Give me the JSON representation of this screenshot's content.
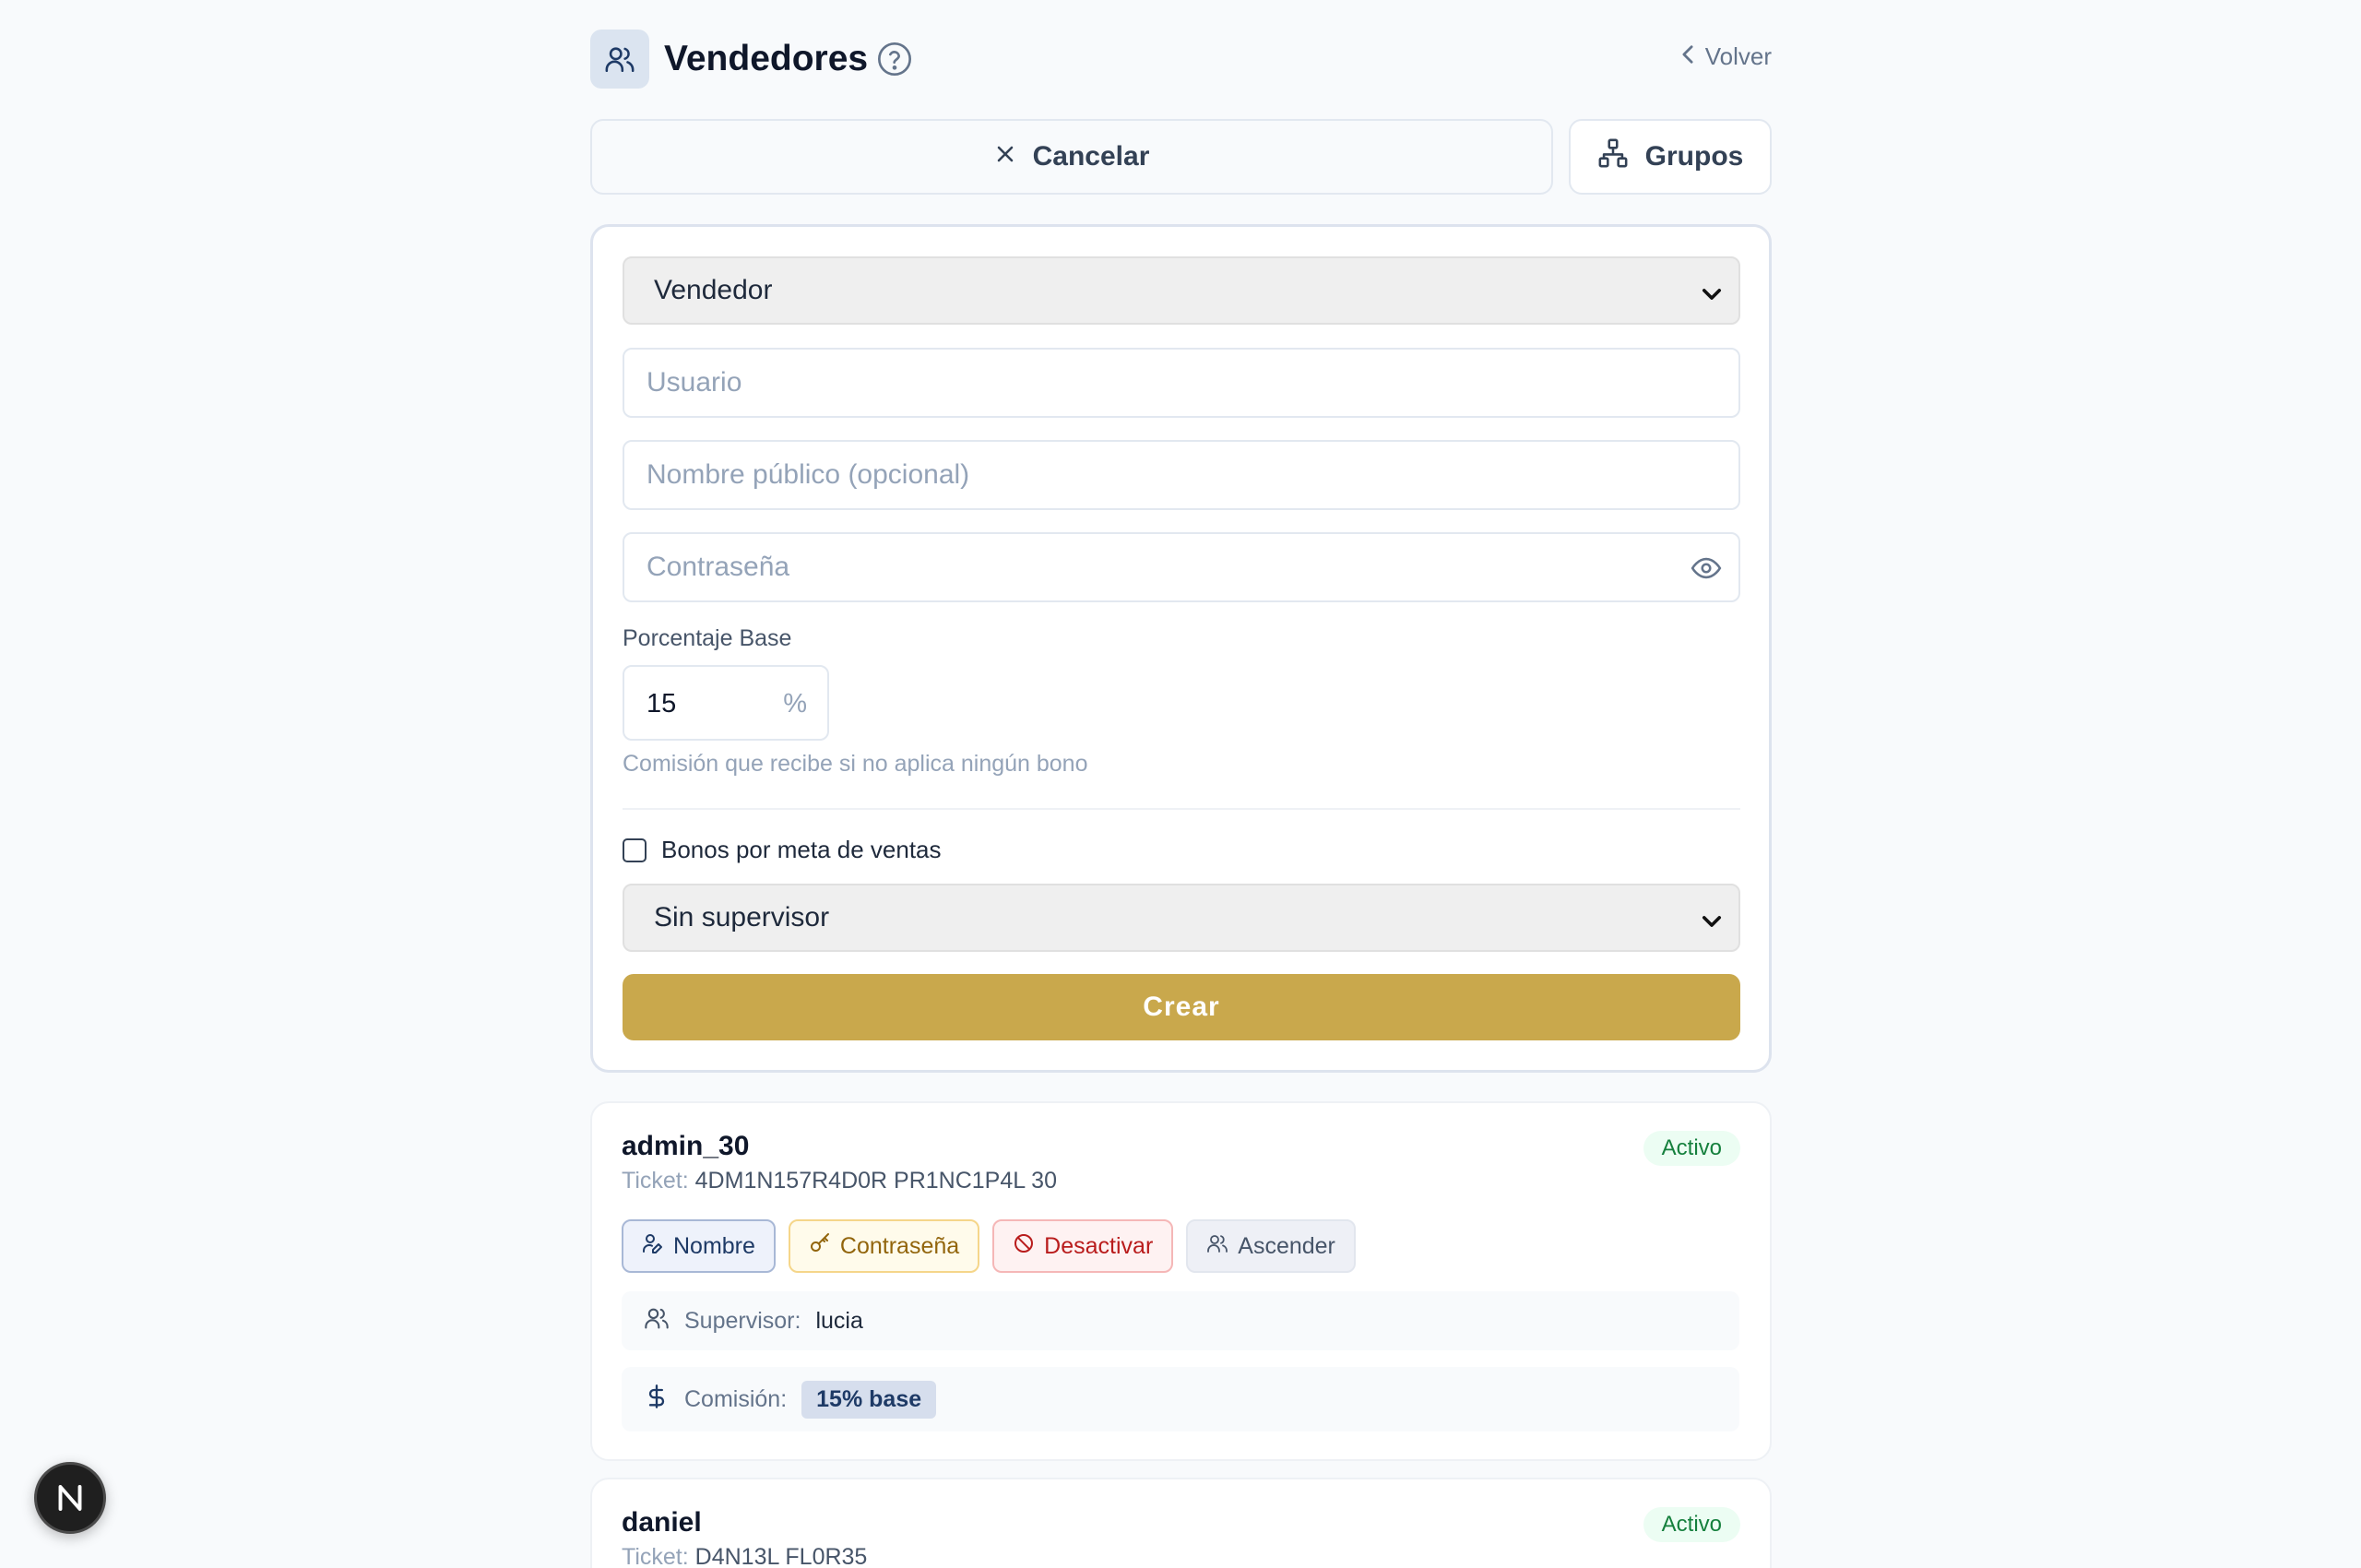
{
  "header": {
    "title": "Vendedores",
    "back_label": "Volver"
  },
  "actions": {
    "cancel_label": "Cancelar",
    "groups_label": "Grupos"
  },
  "form": {
    "role_select": {
      "selected": "Vendedor"
    },
    "username": {
      "placeholder": "Usuario"
    },
    "public_name": {
      "placeholder": "Nombre público (opcional)"
    },
    "password": {
      "placeholder": "Contraseña"
    },
    "base_percent": {
      "label": "Porcentaje Base",
      "value": "15",
      "unit": "%",
      "hint": "Comisión que recibe si no aplica ningún bono"
    },
    "bonus_checkbox": {
      "label": "Bonos por meta de ventas",
      "checked": false
    },
    "supervisor_select": {
      "selected": "Sin supervisor"
    },
    "submit_label": "Crear"
  },
  "vendors": [
    {
      "name": "admin_30",
      "ticket_label": "Ticket:",
      "ticket": "4DM1N157R4D0R PR1NC1P4L 30",
      "status": "Activo",
      "actions": {
        "name": "Nombre",
        "password": "Contraseña",
        "deactivate": "Desactivar",
        "promote": "Ascender"
      },
      "supervisor_label": "Supervisor:",
      "supervisor": "lucia",
      "commission_label": "Comisión:",
      "commission": "15% base"
    },
    {
      "name": "daniel",
      "ticket_label": "Ticket:",
      "ticket": "D4N13L FL0R35",
      "status": "Activo"
    }
  ],
  "colors": {
    "accent": "#c9a84c",
    "active": "#15803d",
    "danger": "#b91c1c"
  },
  "floating": {
    "label": "N"
  }
}
